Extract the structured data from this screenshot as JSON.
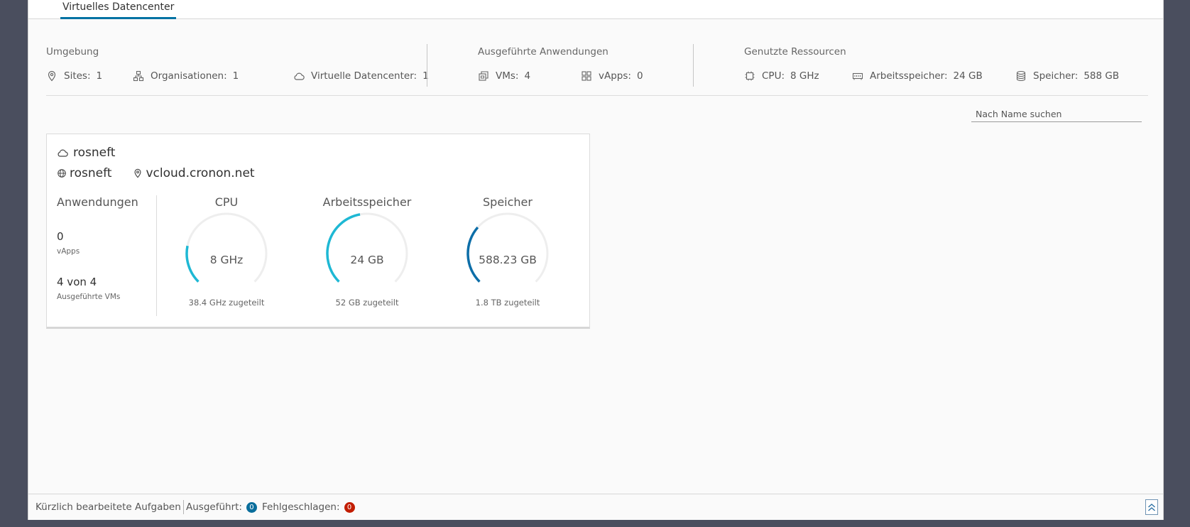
{
  "tabs": [
    {
      "label": "Virtuelles Datencenter",
      "active": true
    }
  ],
  "summary": {
    "environment": {
      "title": "Umgebung",
      "sites": {
        "label": "Sites:",
        "value": "1"
      },
      "organizations": {
        "label": "Organisationen:",
        "value": "1"
      },
      "vdcs": {
        "label": "Virtuelle Datencenter:",
        "value": "1"
      }
    },
    "running_apps": {
      "title": "Ausgeführte Anwendungen",
      "vms": {
        "label": "VMs:",
        "value": "4"
      },
      "vapps": {
        "label": "vApps:",
        "value": "0"
      }
    },
    "resources": {
      "title": "Genutzte Ressourcen",
      "cpu": {
        "label": "CPU:",
        "value": "8 GHz"
      },
      "memory": {
        "label": "Arbeitsspeicher:",
        "value": "24 GB"
      },
      "storage": {
        "label": "Speicher:",
        "value": "588 GB"
      }
    }
  },
  "search": {
    "placeholder": "Nach Name suchen",
    "value": ""
  },
  "card": {
    "vdc_name": "rosneft",
    "org_name": "rosneft",
    "site_name": "vcloud.cronon.net",
    "applications": {
      "title": "Anwendungen",
      "vapps_count": "0",
      "vapps_label": "vApps",
      "vms_count": "4 von 4",
      "vms_label": "Ausgeführte VMs"
    },
    "gauges": [
      {
        "title": "CPU",
        "value": "8 GHz",
        "sub": "38.4 GHz zugeteilt",
        "fraction": 0.208,
        "color": "#1eb8d4"
      },
      {
        "title": "Arbeitsspeicher",
        "value": "24 GB",
        "sub": "52 GB zugeteilt",
        "fraction": 0.462,
        "color": "#1eb8d4"
      },
      {
        "title": "Speicher",
        "value": "588.23 GB",
        "sub": "1.8 TB zugeteilt",
        "fraction": 0.319,
        "color": "#0d6ea8"
      }
    ]
  },
  "footer": {
    "recent_tasks": "Kürzlich bearbeitete Aufgaben",
    "running_label": "Ausgeführt:",
    "running_count": "0",
    "running_color": "#0a6e9c",
    "failed_label": "Fehlgeschlagen:",
    "failed_count": "0",
    "failed_color": "#c21d00"
  }
}
